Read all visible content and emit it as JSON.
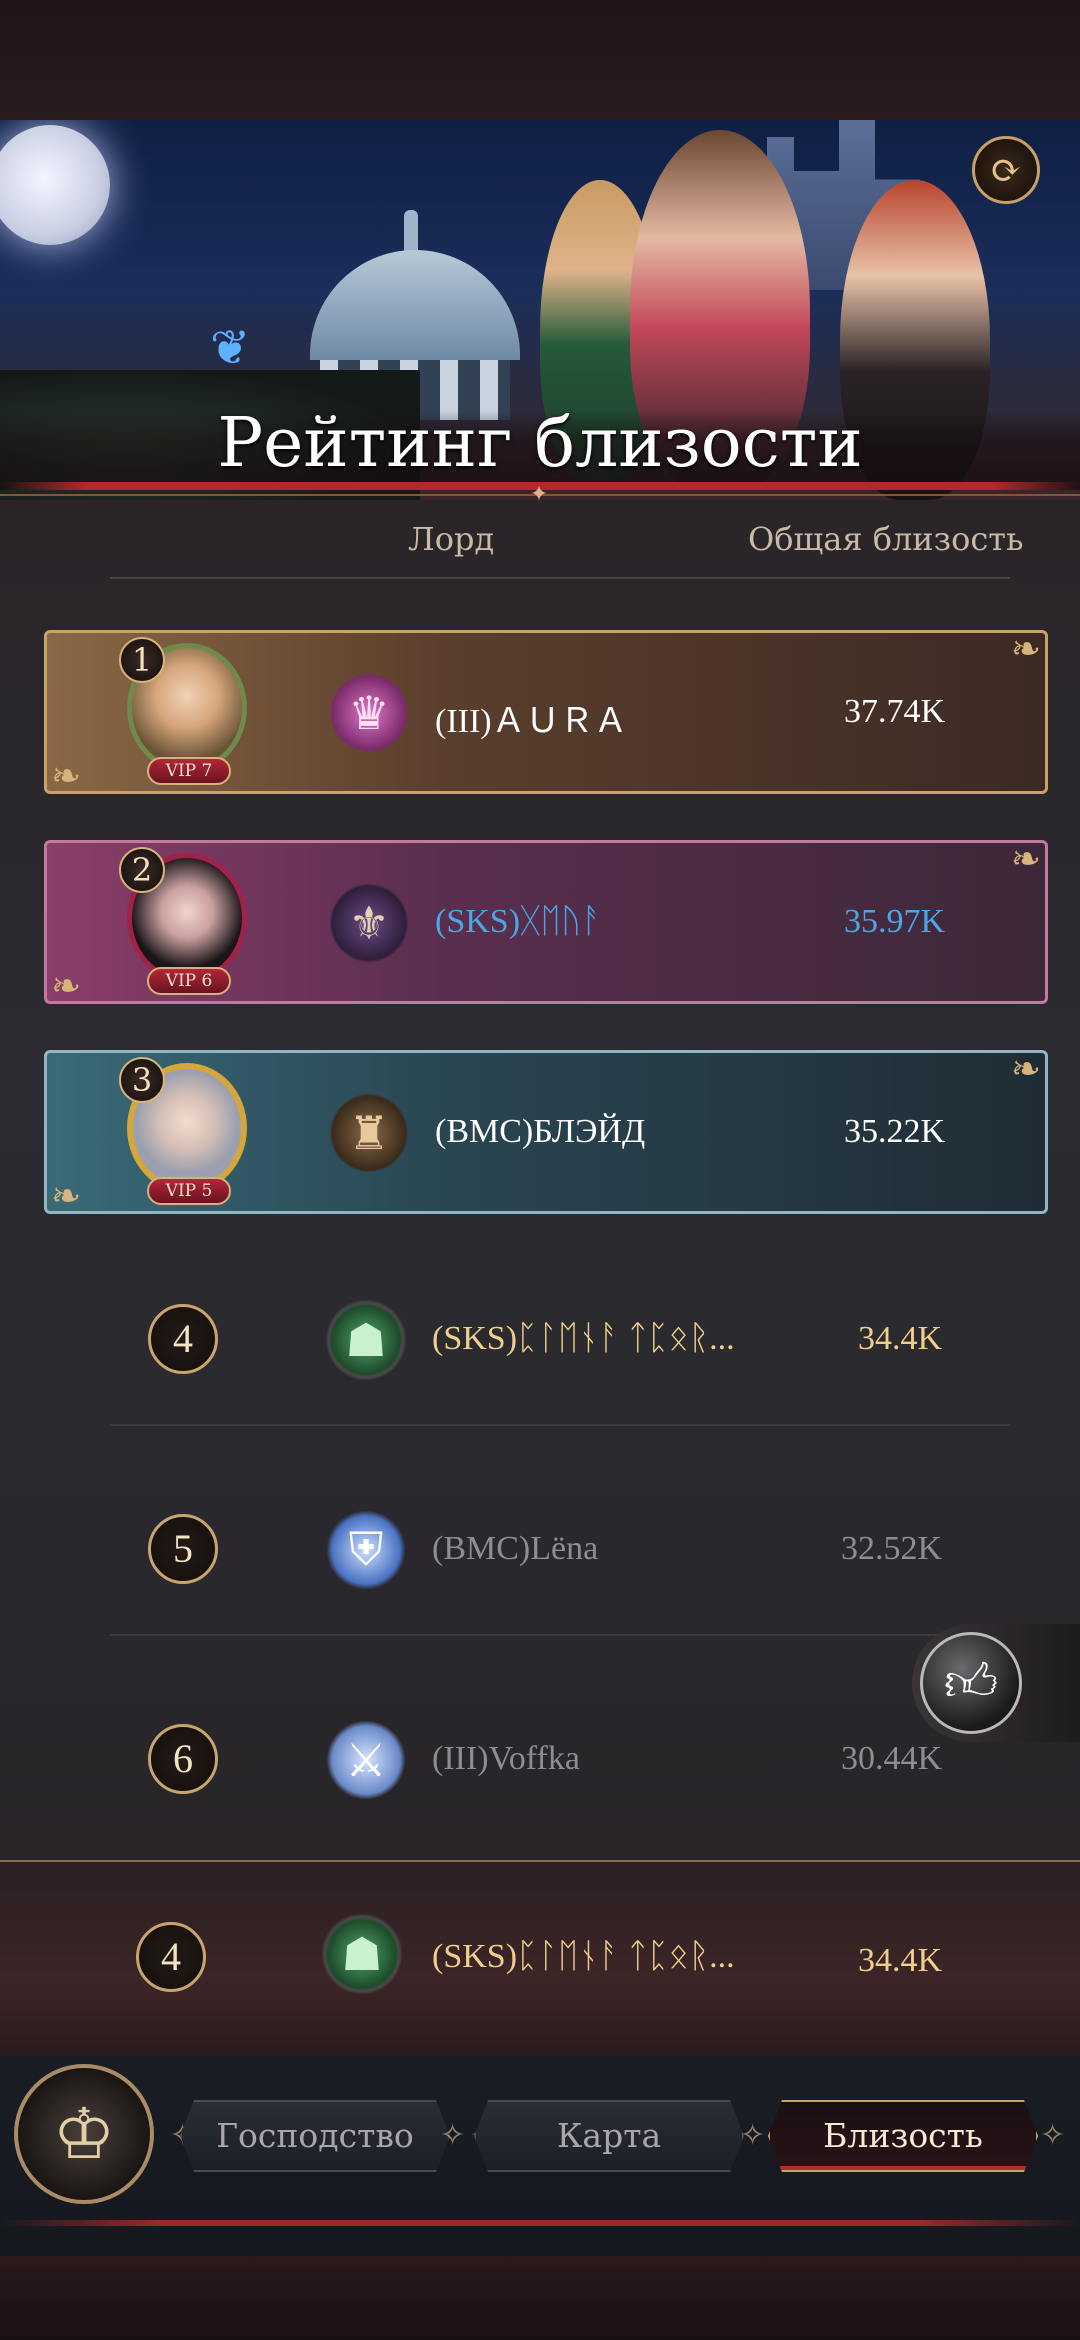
{
  "header": {
    "title": "Рейтинг близости",
    "col_lord": "Лорд",
    "col_total": "Общая близость"
  },
  "top_rows": [
    {
      "rank": "1",
      "vip": "VIP 7",
      "name": "(III)ＡＵＲＡ",
      "score": "37.74K",
      "name_color": "#ffffff",
      "score_color": "#ffffff"
    },
    {
      "rank": "2",
      "vip": "VIP 6",
      "name": "(SKS)ᚷᛖᚢᚨ",
      "score": "35.97K",
      "name_color": "#4aa6e6",
      "score_color": "#4aa6e6"
    },
    {
      "rank": "3",
      "vip": "VIP 5",
      "name": "(BMC)БЛЭЙД",
      "score": "35.22K",
      "name_color": "#ffffff",
      "score_color": "#ffffff"
    }
  ],
  "rows": [
    {
      "rank": "4",
      "name": "(SKS)ᛈᛚᛖᚾᚨ ᛏᛈᛟᚱ...",
      "score": "34.4K",
      "name_color": "#f0cf8e",
      "score_color": "#f0cf8e"
    },
    {
      "rank": "5",
      "name": "(BMC)Lëna",
      "score": "32.52K",
      "name_color": "#8e8c94",
      "score_color": "#8e8c94"
    },
    {
      "rank": "6",
      "name": "(III)Voffka",
      "score": "30.44K",
      "name_color": "#8e8c94",
      "score_color": "#8e8c94"
    }
  ],
  "my_rank": {
    "rank": "4",
    "name": "(SKS)ᛈᛚᛖᚾᚨ ᛏᛈᛟᚱ...",
    "score": "34.4K",
    "color": "#f0cf8e"
  },
  "nav": {
    "tab_dominion": "Господство",
    "tab_map": "Карта",
    "tab_affinity": "Близость"
  },
  "icons": {
    "refresh": "refresh-icon",
    "like": "thumbs-up-icon",
    "home": "crown-emblem-icon"
  }
}
